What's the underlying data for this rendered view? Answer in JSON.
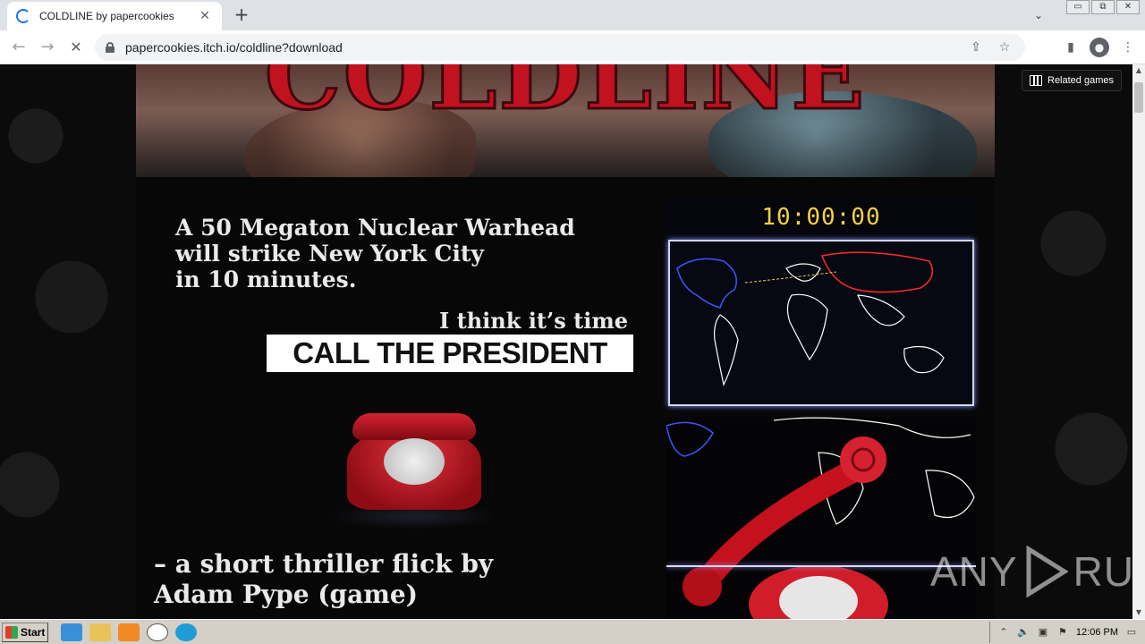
{
  "browser": {
    "tab_title": "COLDLINE by papercookies",
    "tab_close": "✕",
    "new_tab": "+",
    "tab_list": "⌄",
    "url": "papercookies.itch.io/coldline?download",
    "window_buttons": [
      "▭",
      "⧉",
      "✕"
    ]
  },
  "page": {
    "related_games": "Related games",
    "banner_logo": "COLDLINE",
    "headline": [
      "A 50 Megaton Nuclear Warhead",
      "will strike New York City",
      "in 10 minutes."
    ],
    "tagline": "I think it’s time to",
    "cta": "CALL THE PRESIDENT",
    "timer": "10:00:00",
    "credit": [
      "– a short thriller flick by",
      "Adam Pype (game)"
    ],
    "watermark": "ANY RUN",
    "watermark_left": "ANY",
    "watermark_right": "RUN"
  },
  "taskbar": {
    "start_label": "Start",
    "clock": "12:06 PM"
  },
  "colors": {
    "accent_red": "#c1121f",
    "timer_yellow": "#f5d142",
    "map_glow": "#cfd6f0"
  }
}
